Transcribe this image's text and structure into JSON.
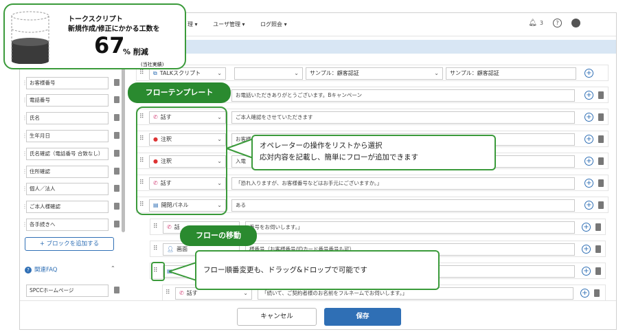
{
  "hero": {
    "title": "トークスクリプト",
    "subtitle": "新規作成/修正にかかる工数を",
    "number": "67",
    "unit": "% 削減",
    "note": "(当社実績)",
    "reduction_fraction": 0.67
  },
  "nav": {
    "items": [
      "理 ▾",
      "ユーザ管理 ▾",
      "ログ照会 ▾"
    ],
    "notif_count": "3"
  },
  "left": {
    "items": [
      "お客様番号",
      "電話番号",
      "氏名",
      "生年月日",
      "氏名確認（電話番号 合致なし）",
      "住所確認",
      "個人／法人",
      "ご本人様確認",
      "各手続きへ"
    ],
    "add_block": "+ ブロックを追加する",
    "faq_label": "関連FAQ",
    "faq_item": "SPCCホームページ"
  },
  "flow": {
    "header": {
      "script_select": "TALKスクリプト",
      "sample1": "サンプル：顧客認証",
      "sample2": "サンプル：顧客認証"
    },
    "rows": [
      {
        "op": "",
        "text": "お電話いただきありがとうございます。Bキャンペーン"
      },
      {
        "op": "話す",
        "text": "ご本人確認をさせていただきます"
      },
      {
        "op": "注釈",
        "text": "お客様"
      },
      {
        "op": "注釈",
        "text": "入電"
      },
      {
        "op": "話す",
        "text": "「恐れ入りますが、お客様番号などはお手元にございますか。」"
      },
      {
        "op": "開閉パネル",
        "text": "ある"
      },
      {
        "op": "話",
        "text": "番号をお伺いします。」"
      },
      {
        "op": "画面",
        "text": "様番号（お客様番号/IDカード番号番号も可）"
      },
      {
        "op": "",
        "text": ""
      },
      {
        "op": "話す",
        "text": "「続いて、ご契約者様のお名前をフルネームでお伺いします。」"
      }
    ]
  },
  "annotations": {
    "flow_template": "フローテンプレート",
    "flow_move": "フローの移動",
    "callout1_line1": "オペレーターの操作をリストから選択",
    "callout1_line2": "応対内容を記載し、簡単にフローが追加できます",
    "callout2": "フロー順番変更も、ドラッグ&ドロップで可能です"
  },
  "buttons": {
    "cancel": "キャンセル",
    "save": "保存"
  },
  "colors": {
    "accent_green": "#2a8a2f",
    "primary_blue": "#2f6fb5",
    "panel_blue": "#d8e6f4"
  }
}
